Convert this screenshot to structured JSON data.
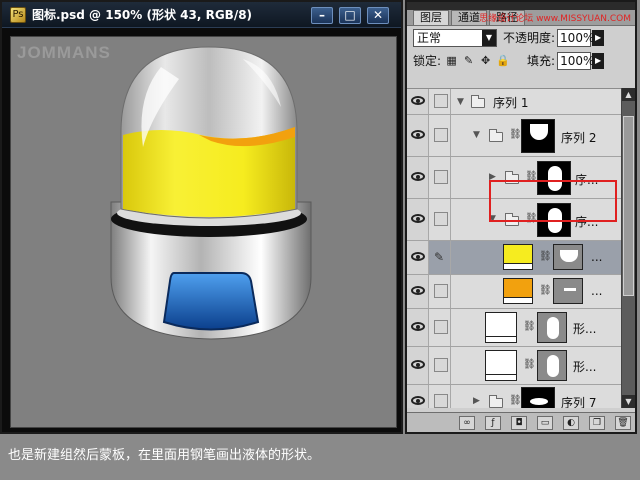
{
  "document": {
    "title": "图标.psd @ 150% (形状 43, RGB/8)",
    "watermark": "JOMMANS",
    "buttons": {
      "minimize": "–",
      "maximize": "□",
      "close": "✕"
    }
  },
  "panel": {
    "tabs": [
      "图层",
      "通道",
      "路径"
    ],
    "tab_watermark": "思缘设计论坛 www.MISSYUAN.COM",
    "blend_mode": "正常",
    "opacity_label": "不透明度:",
    "opacity_value": "100%",
    "lock_label": "锁定:",
    "fill_label": "填充:",
    "fill_value": "100%",
    "layers": [
      {
        "label": "序列 1"
      },
      {
        "label": "序列 2"
      },
      {
        "label": "序..."
      },
      {
        "label": "序..."
      },
      {
        "label": "..."
      },
      {
        "label": "..."
      },
      {
        "label": "形..."
      },
      {
        "label": "形..."
      },
      {
        "label": "序列 7"
      }
    ]
  },
  "caption": "也是新建组然后蒙板，在里面用钢笔画出液体的形状。",
  "colors": {
    "liquid_yellow": "#f6ec1f",
    "liquid_orange": "#f2a10e",
    "visor_blue": "#1f6fc8",
    "highlight_red": "#e02020"
  }
}
